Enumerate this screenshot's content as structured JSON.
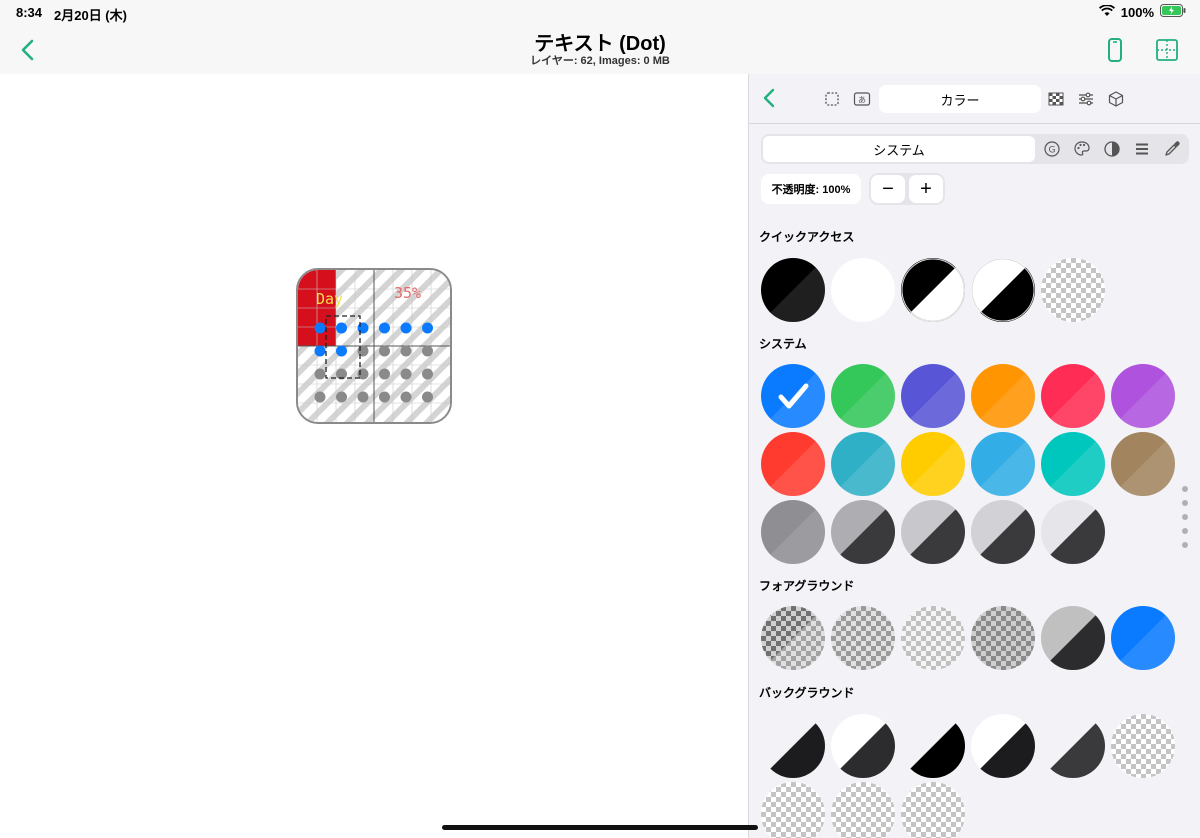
{
  "status": {
    "time": "8:34",
    "date": "2月20日 (木)",
    "battery": "100%"
  },
  "nav": {
    "title": "テキスト (Dot)",
    "subtitle": "レイヤー: 62, Images: 0 MB",
    "accent": "#22b07d"
  },
  "canvas": {
    "tile_text_left": "Day",
    "tile_text_right": "35%"
  },
  "panel": {
    "segment_label": "カラー",
    "sub_segment_label": "システム",
    "opacity_label": "不透明度: 100%",
    "minus_label": "−",
    "plus_label": "+",
    "sections": {
      "quick": "クイックアクセス",
      "system": "システム",
      "foreground": "フォアグラウンド",
      "background": "バックグラウンド"
    },
    "quick_colors": [
      "#000000",
      "#ffffff",
      "split-black-white",
      "split-white-black",
      "checker"
    ],
    "system_colors": [
      "#0a7aff",
      "#34c759",
      "#5856d6",
      "#ff9500",
      "#ff2d55",
      "#af52de",
      "#ff3b30",
      "#30b0c7",
      "#ffcc00",
      "#32ade6",
      "#00c7be",
      "#a2845e",
      "#8e8e93",
      "#aeaeb2",
      "#c7c7cc",
      "#d1d1d6",
      "#e5e5ea"
    ],
    "system_selected": 0,
    "foreground_colors": [
      "checker-dark",
      "checker-mid",
      "checker-light",
      "checker-mid2",
      "split-gray-dark",
      "#0a7aff"
    ],
    "background_colors": [
      "split-gray-black",
      "split-white-dark",
      "split-black",
      "split-white-dark2",
      "split-gray-dark2",
      "checker",
      "checker",
      "checker",
      "checker"
    ]
  }
}
